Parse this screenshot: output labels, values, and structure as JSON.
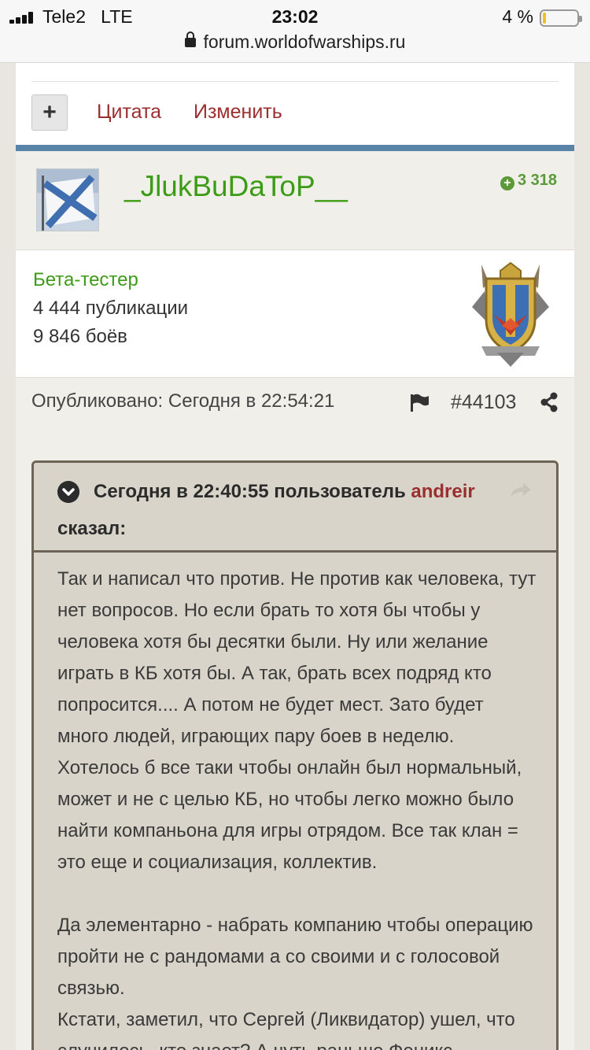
{
  "status_bar": {
    "carrier": "Tele2",
    "network": "LTE",
    "time": "23:02",
    "battery_percent": "4 %",
    "battery_level": 0.04,
    "url": "forum.worldofwarships.ru"
  },
  "prev_post": {
    "plus_label": "+",
    "quote_label": "Цитата",
    "edit_label": "Изменить"
  },
  "author": {
    "name": "_JlukBuDaToP__",
    "reputation": "3 318",
    "group": "Бета-тестер",
    "publications": "4 444 публикации",
    "battles": "9 846 боёв"
  },
  "meta": {
    "published": "Опубликовано: Сегодня в 22:54:21",
    "post_number": "#44103"
  },
  "quote": {
    "header_prefix": "Сегодня в 22:40:55 пользователь",
    "user": "andreir",
    "header_suffix": "сказал:",
    "paragraphs": [
      "Так  и написал что против. Не против как человека, тут нет вопросов. Но если брать то хотя бы чтобы у человека хотя бы десятки были. Ну или желание играть в КБ хотя бы. А так, брать всех подряд кто попросится.... А потом не будет мест. Зато будет много людей, играющих пару боев в неделю. Хотелось б все таки чтобы онлайн был нормальный, может и не с целью КБ, но чтобы легко можно было найти компаньона для игры отрядом. Все так клан = это еще и социализация, коллектив.",
      "Да элементарно - набрать компанию чтобы операцию пройти не с рандомами а со своими и с голосовой связью.",
      "Кстати, заметил, что Сергей (Ликвидатор) ушел, что случилось, кто знает? А чуть раньше Феникс"
    ]
  },
  "colors": {
    "accent_green": "#3d9c16",
    "link_red": "#9b2e2e",
    "divider_blue": "#5a83a8"
  },
  "icons": {
    "flag": "flag-icon",
    "share": "share-icon",
    "chevron": "chevron-down-icon",
    "reply": "reply-icon",
    "lock": "lock-icon"
  }
}
